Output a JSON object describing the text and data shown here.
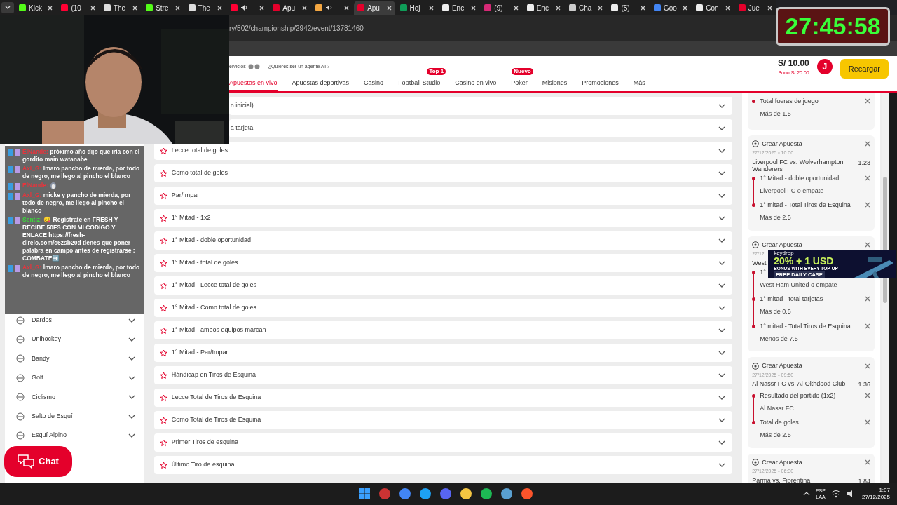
{
  "browser": {
    "tabs": [
      {
        "label": "Kick",
        "color": "#53fc18",
        "selected": false
      },
      {
        "label": "(10",
        "color": "#ff0033",
        "selected": false
      },
      {
        "label": "The",
        "color": "#dddddd",
        "selected": false
      },
      {
        "label": "Stre",
        "color": "#53fc18",
        "selected": false
      },
      {
        "label": "The",
        "color": "#dddddd",
        "selected": false
      },
      {
        "color": "#ff0033",
        "audio": true,
        "selected": false
      },
      {
        "label": "Apu",
        "color": "#e4002b",
        "selected": false
      },
      {
        "color": "#f4a742",
        "audio": true,
        "selected": false
      },
      {
        "label": "Apu",
        "color": "#e4002b",
        "selected": true
      },
      {
        "label": "Hoj",
        "color": "#0f9d58",
        "selected": false
      },
      {
        "label": "Enc",
        "color": "#eeeeee",
        "selected": false
      },
      {
        "label": "(9)",
        "color": "#d62976",
        "selected": false
      },
      {
        "label": "Enc",
        "color": "#eeeeee",
        "selected": false
      },
      {
        "label": "Cha",
        "color": "#cccccc",
        "selected": false
      },
      {
        "label": "(5)",
        "color": "#eeeeee",
        "selected": false
      },
      {
        "label": "Goo",
        "color": "#4285f4",
        "selected": false
      },
      {
        "label": "Con",
        "color": "#eeeeee",
        "selected": false
      },
      {
        "label": "Jue",
        "color": "#e4002b",
        "selected": false
      }
    ],
    "url": "ry/502/championship/2942/event/13781460"
  },
  "timer": "27:45:58",
  "header": {
    "services_text": "ervicios",
    "agent_link": "¿Quieres ser un agente AT?",
    "balance": "S/ 10.00",
    "bonus": "Bono S/ 20.00",
    "avatar": "J",
    "recharge_button": "Recargar",
    "nav": [
      {
        "label": "Apuestas en vivo",
        "selected": true
      },
      {
        "label": "Apuestas deportivas",
        "selected": false
      },
      {
        "label": "Casino",
        "selected": false
      },
      {
        "label": "Football Studio",
        "badge": "Top 1",
        "selected": false
      },
      {
        "label": "Casino en vivo",
        "selected": false
      },
      {
        "label": "Poker",
        "badge": "Nuevo",
        "selected": false
      },
      {
        "label": "Misiones",
        "selected": false
      },
      {
        "label": "Promociones",
        "selected": false
      },
      {
        "label": "Más",
        "selected": false
      }
    ]
  },
  "sidebar": {
    "items": [
      {
        "label": "Dardos"
      },
      {
        "label": "Unihockey"
      },
      {
        "label": "Bandy"
      },
      {
        "label": "Golf"
      },
      {
        "label": "Ciclismo"
      },
      {
        "label": "Salto de Esquí"
      },
      {
        "label": "Esquí Alpino"
      }
    ]
  },
  "chat_button": "Chat",
  "chat_overlay": [
    {
      "user": "ElNande:",
      "color": "#e8343c",
      "text": "próximo año dijo que iría con el gordito main watanabe"
    },
    {
      "user": "Axl_G:",
      "color": "#e8343c",
      "text": "lmaro pancho de mierda, por todo de negro, me llego al pincho el blanco"
    },
    {
      "user": "ElNande:",
      "color": "#e8343c",
      "kind": "emote"
    },
    {
      "user": "Axl_G:",
      "color": "#e8343c",
      "text": "micke y pancho de mierda, por todo de negro, me llego al pincho el blanco"
    },
    {
      "user": "Sentiz:",
      "color": "#3cd63c",
      "text": "😋 Regístrate en FRESH Y RECIBE 50FS CON MI CODIGO Y ENLACE https://fresh-direlo.com/c6zsb20d tienes que poner palabra en campo antes de registrarse : COMBATE➡️"
    },
    {
      "user": "Axl_G:",
      "color": "#e8343c",
      "text": "lmaro pancho de mierda, por todo de negro, me llego al pincho el blanco"
    }
  ],
  "markets": [
    {
      "label": "n inicial)",
      "cut": true
    },
    {
      "label": "a tarjeta",
      "cut": true
    },
    {
      "label": "Lecce total de goles"
    },
    {
      "label": "Como total de goles"
    },
    {
      "label": "Par/Impar"
    },
    {
      "label": "1° Mitad - 1x2"
    },
    {
      "label": "1° Mitad - doble oportunidad"
    },
    {
      "label": "1° Mitad - total de goles"
    },
    {
      "label": "1° Mitad - Lecce total de goles"
    },
    {
      "label": "1° Mitad - Como total de goles"
    },
    {
      "label": "1° Mitad - ambos equipos marcan"
    },
    {
      "label": "1° Mitad - Par/Impar"
    },
    {
      "label": "Hándicap en Tiros de Esquina"
    },
    {
      "label": "Lecce Total de Tiros de Esquina"
    },
    {
      "label": "Como Total de Tiros de Esquina"
    },
    {
      "label": "Primer Tiros de esquina"
    },
    {
      "label": "Último Tiro de esquina"
    }
  ],
  "bet_slip": [
    {
      "cut_top": true,
      "selections": [
        {
          "market": "Total fueras de juego",
          "pick": "Más de 1.5"
        }
      ]
    },
    {
      "title": "Crear Apuesta",
      "date": "27/12/2025 • 10:00",
      "match": "Liverpool FC vs. Wolverhampton Wanderers",
      "odds": "1.23",
      "selections": [
        {
          "market": "1° Mitad - doble oportunidad",
          "pick": "Liverpool FC o empate"
        },
        {
          "market": "1° mitad - Total Tiros de Esquina",
          "pick": "Más de 2.5"
        }
      ]
    },
    {
      "title": "Crear Apuesta",
      "date": "27/12",
      "match": "West",
      "selections": [
        {
          "market": "1°",
          "pick": "West Ham United o empate"
        },
        {
          "market": "1° mitad - total tarjetas",
          "pick": "Más de 0.5"
        },
        {
          "market": "1° mitad - Total Tiros de Esquina",
          "pick": "Menos de 7.5"
        }
      ]
    },
    {
      "title": "Crear Apuesta",
      "date": "27/12/2025 • 09:50",
      "match": "Al Nassr FC vs. Al-Okhdood Club",
      "odds": "1.36",
      "selections": [
        {
          "market": "Resultado del partido (1x2)",
          "pick": "Al Nassr FC"
        },
        {
          "market": "Total de goles",
          "pick": "Más de 2.5"
        }
      ]
    },
    {
      "title": "Crear Apuesta",
      "date": "27/12/2025 • 06:30",
      "match": "Parma vs. Fiorentina",
      "odds": "1.84"
    }
  ],
  "ad": {
    "brand": "keydrop",
    "headline": "20% + 1 USD",
    "subline": "BONUS WITH EVERY TOP-UP",
    "cta": "FREE DAILY CASE"
  },
  "taskbar": {
    "lang": "ESP",
    "layout": "LAA",
    "time": "1:07",
    "date": "27/12/2025"
  }
}
